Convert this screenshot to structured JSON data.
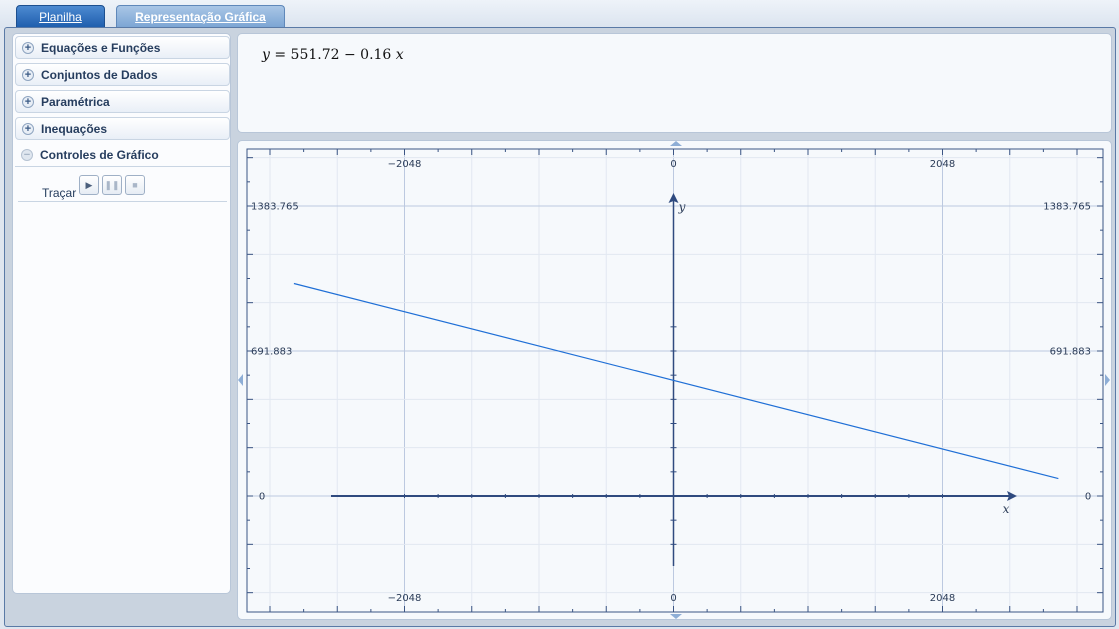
{
  "tabs": [
    {
      "label": "Planilha"
    },
    {
      "label": "Representação Gráfica"
    }
  ],
  "sidebar": {
    "sections": [
      {
        "label": "Equações e Funções"
      },
      {
        "label": "Conjuntos de Dados"
      },
      {
        "label": "Paramétrica"
      },
      {
        "label": "Inequações"
      },
      {
        "label": "Controles de Gráfico"
      }
    ],
    "trace": {
      "label": "Traçar",
      "buttons": [
        {
          "icon": "play-icon"
        },
        {
          "icon": "pause-icon"
        },
        {
          "icon": "stop-icon"
        }
      ]
    }
  },
  "equation": {
    "text": "𝑦 = 551.72 − 0.16 𝑥"
  },
  "chart_data": {
    "type": "line",
    "title": "",
    "xlabel": "x",
    "ylabel": "y",
    "xlim": [
      -3072,
      3072
    ],
    "ylim": [
      -553,
      1591
    ],
    "x_ticks": [
      -2048,
      0,
      2048
    ],
    "y_ticks": [
      0,
      691.883,
      1383.765
    ],
    "x_tick_labels": [
      "−2048",
      "0",
      "2048"
    ],
    "y_tick_labels": [
      "0",
      "691.883",
      "1383.765"
    ],
    "grid": true,
    "series": [
      {
        "color": "#1f6fd6",
        "x": [
          -2890,
          2930
        ],
        "y": [
          1014,
          83
        ]
      }
    ],
    "axis_color": "#2f4a7f"
  }
}
